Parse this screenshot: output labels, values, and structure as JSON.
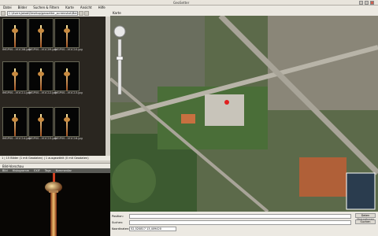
{
  "window": {
    "title": "GeoSetter"
  },
  "menu": [
    "Datei",
    "Bilder",
    "Suchen & Filtern",
    "Karte",
    "Ansicht",
    "Hilfe"
  ],
  "path": "C:\\Users\\Jakob\\Desktop\\geosetter_screenshot\\Berlin",
  "thumbnails": [
    {
      "caption": "IMGP00...VI1C08.jpg"
    },
    {
      "caption": "IMGP00...VI1C09.jpg"
    },
    {
      "caption": "IMGP00...VI1C10.jpg"
    },
    {
      "caption": "IMGP00...VI1C11.jpg"
    },
    {
      "caption": "IMGP00...VI1C12.jpg"
    },
    {
      "caption": "IMGP00...VI1C13.jpg"
    },
    {
      "caption": "IMGP00...VI1C14.jpg"
    },
    {
      "caption": "IMGP00...VI1C15.jpg"
    },
    {
      "caption": "IMGP00...VI1C16.jpg"
    }
  ],
  "status_left": "1 | 15 Bilder (1 mit Geodaten) | 1 ausgewählt (0 mit Geodaten)",
  "preview": {
    "title": "Bild-Vorschau",
    "tabs": [
      "Bild",
      "Histogramm",
      "EXIF",
      "Tags",
      "Kommentar"
    ]
  },
  "map": {
    "title": "Karte"
  },
  "bottom": {
    "fields": [
      {
        "label": "Position:",
        "value": ""
      },
      {
        "label": "Suchen:",
        "value": ""
      },
      {
        "label": "Koordinaten:",
        "value": "52,520817 13,409420"
      }
    ],
    "buttons": [
      "Daten übernehmen",
      "Suchen"
    ]
  }
}
